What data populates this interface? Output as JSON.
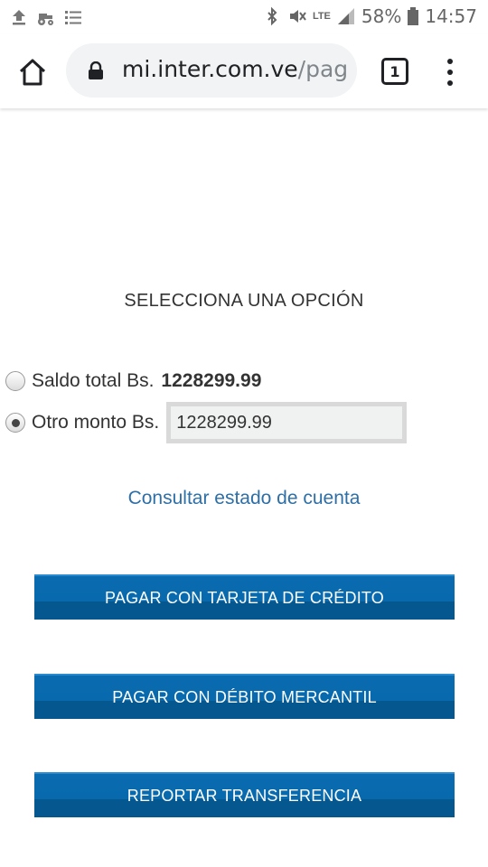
{
  "status_bar": {
    "icons_left": [
      "upload-icon",
      "tractor-icon",
      "list-icon"
    ],
    "icons_right": [
      "bluetooth-icon",
      "mute-icon",
      "lte-icon",
      "signal-icon"
    ],
    "lte": "LTE",
    "battery": "58%",
    "time": "14:57"
  },
  "browser": {
    "url_main": "mi.inter.com.ve",
    "url_rest": "/pag",
    "tab_count": "1"
  },
  "content": {
    "title": "SELECCIONA UNA OPCIÓN",
    "option_total_label": "Saldo total Bs.",
    "option_total_amount": "1228299.99",
    "option_other_label": "Otro monto Bs.",
    "option_other_value": "1228299.99",
    "account_link": "Consultar estado de cuenta",
    "buttons": {
      "credit_card": "PAGAR CON TARJETA DE CRÉDITO",
      "debit": "PAGAR CON DÉBITO MERCANTIL",
      "transfer": "REPORTAR TRANSFERENCIA"
    }
  },
  "colors": {
    "button_blue": "#0869ad",
    "link_blue": "#2d6fa7"
  }
}
